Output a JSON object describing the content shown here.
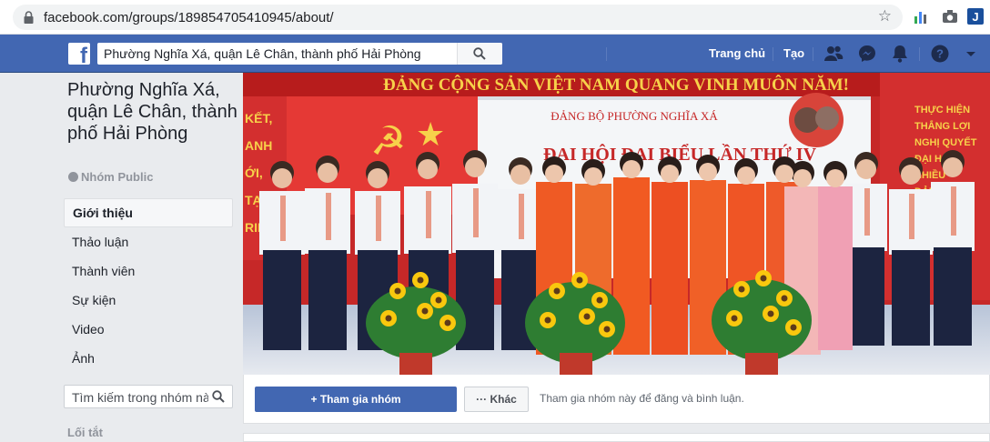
{
  "browser": {
    "url": "facebook.com/groups/189854705410945/about/"
  },
  "topbar": {
    "search_value": "Phường Nghĩa Xá, quận Lê Chân, thành phố Hải Phòng",
    "home_label": "Trang chủ",
    "create_label": "Tạo",
    "brand_color": "#4267b2"
  },
  "group": {
    "title": "Phường Nghĩa Xá, quận Lê Chân, thành phố Hải Phòng",
    "privacy": "Nhóm Public"
  },
  "sidebar": {
    "items": [
      {
        "label": "Giới thiệu",
        "active": true
      },
      {
        "label": "Thảo luận"
      },
      {
        "label": "Thành viên"
      },
      {
        "label": "Sự kiện"
      },
      {
        "label": "Video"
      },
      {
        "label": "Ảnh"
      }
    ],
    "search_placeholder": "Tìm kiếm trong nhóm nà",
    "shortcuts_label": "Lối tắt"
  },
  "cover": {
    "banner_text": "ĐẢNG CỘNG SẢN VIỆT NAM QUANG VINH MUÔN NĂM!",
    "board_line1": "ĐẢNG BỘ PHƯỜNG NGHĨA XÁ",
    "board_line2": "ĐẠI HỘI ĐẠI BIỂU LẦN THỨ IV",
    "side_left": "KẾT, ANH ỚI, TẠO, RIỂN",
    "side_right": "THỰC HIỆN THẮNG LỢI NGHỊ QUYẾT ĐẠI HỘI NHIỀU ĐẢNG"
  },
  "actions": {
    "join_label": "Tham gia nhóm",
    "join_prefix": "+",
    "more_label": "Khác",
    "more_prefix": "···",
    "hint": "Tham gia nhóm này để đăng và bình luận."
  }
}
